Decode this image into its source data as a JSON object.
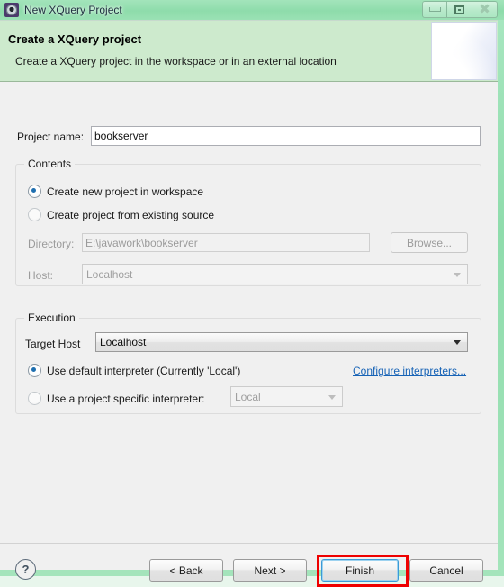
{
  "window": {
    "title": "New XQuery Project",
    "icon": "gear-icon",
    "controls": {
      "minimize": "Minimize",
      "maximize": "Maximize",
      "close": "Close"
    }
  },
  "banner": {
    "title": "Create a XQuery project",
    "subtitle": "Create a XQuery project in the workspace or in an external location"
  },
  "form": {
    "project_name_label": "Project name:",
    "project_name_value": "bookserver",
    "project_name_placeholder": "",
    "contents": {
      "group_title": "Contents",
      "radio_new_workspace": "Create new project in workspace",
      "radio_existing_source": "Create project from existing source",
      "selected": "workspace",
      "directory_label": "Directory:",
      "directory_value": "E:\\javawork\\bookserver",
      "browse_label": "Browse...",
      "host_label": "Host:",
      "host_value": "Localhost"
    },
    "execution": {
      "group_title": "Execution",
      "target_host_label": "Target Host",
      "target_host_value": "Localhost",
      "radio_default_interpreter": "Use default interpreter (Currently 'Local')",
      "radio_specific_interpreter": "Use a project specific interpreter:",
      "selected": "default",
      "configure_link": "Configure interpreters...",
      "interpreter_value": "Local"
    }
  },
  "buttonbar": {
    "help": "?",
    "back": "< Back",
    "next": "Next >",
    "finish": "Finish",
    "cancel": "Cancel",
    "focused_button": "Finish",
    "highlight_color": "#ee0000"
  }
}
